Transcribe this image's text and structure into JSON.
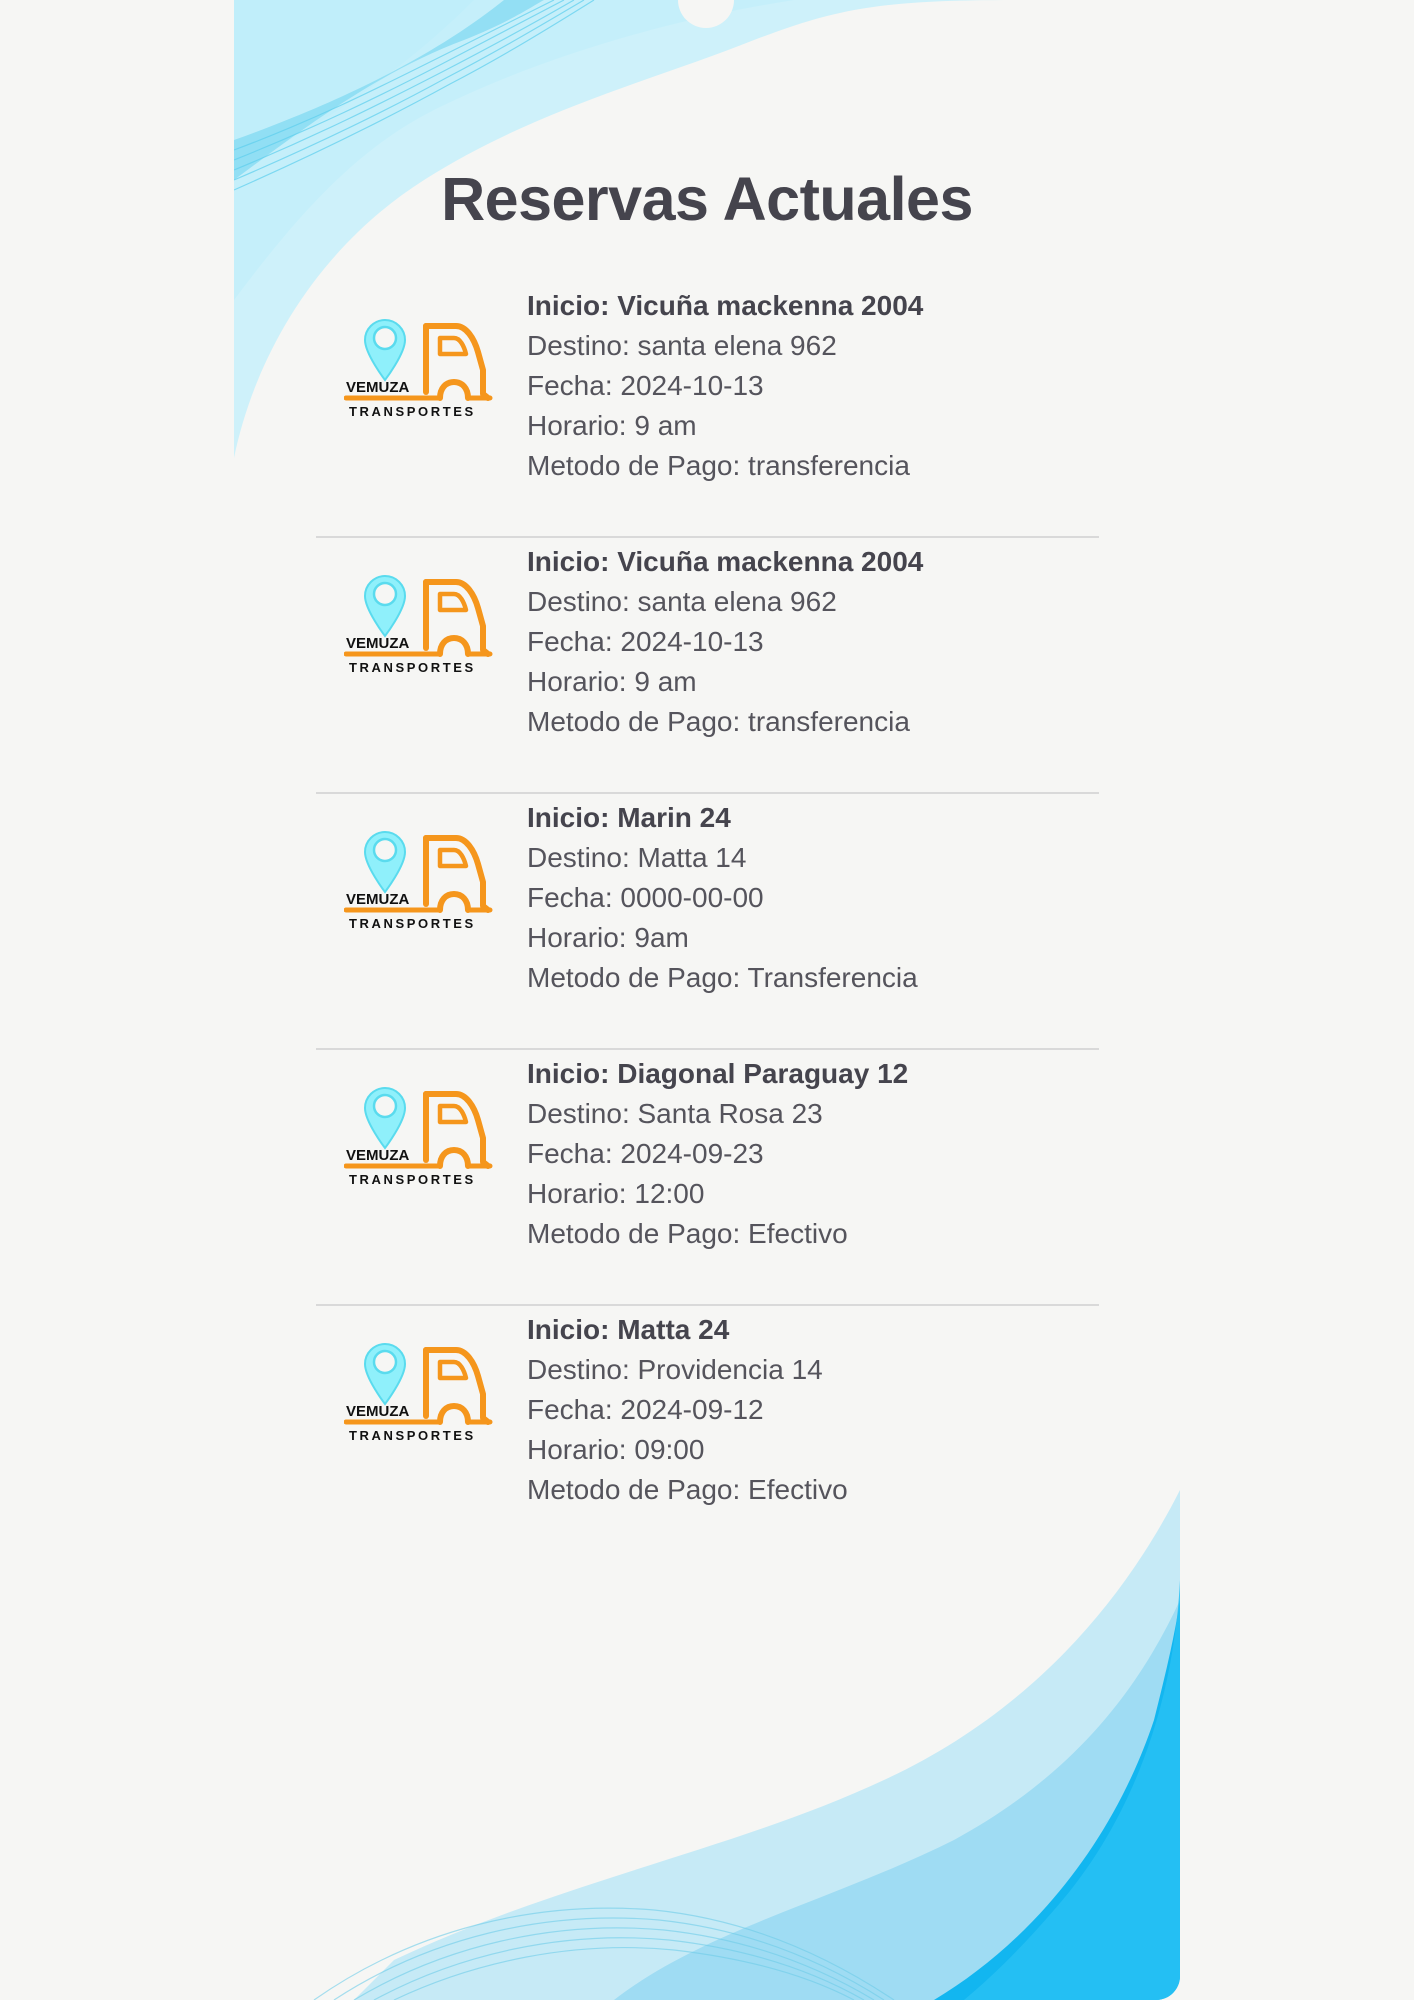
{
  "page_title": "Reservas Actuales",
  "logo": {
    "brand": "VEMUZA",
    "subtitle": "TRANSPORTES"
  },
  "colors": {
    "accent_orange": "#f5961c",
    "accent_cyan": "#6fe3f4",
    "wave_blue": "#12b6f0",
    "title": "#45444d",
    "text": "#55545c"
  },
  "reservations": [
    {
      "inicio": "Inicio: Vicuña mackenna 2004",
      "destino": "Destino: santa elena 962",
      "fecha": "Fecha: 2024-10-13",
      "horario": "Horario: 9 am",
      "pago": "Metodo de Pago: transferencia"
    },
    {
      "inicio": "Inicio: Vicuña mackenna 2004",
      "destino": "Destino: santa elena 962",
      "fecha": "Fecha: 2024-10-13",
      "horario": "Horario: 9 am",
      "pago": "Metodo de Pago: transferencia"
    },
    {
      "inicio": "Inicio: Marin 24",
      "destino": "Destino: Matta 14",
      "fecha": "Fecha: 0000-00-00",
      "horario": "Horario: 9am",
      "pago": "Metodo de Pago: Transferencia"
    },
    {
      "inicio": "Inicio: Diagonal Paraguay 12",
      "destino": "Destino: Santa Rosa 23",
      "fecha": "Fecha: 2024-09-23",
      "horario": "Horario: 12:00",
      "pago": "Metodo de Pago: Efectivo"
    },
    {
      "inicio": "Inicio: Matta 24",
      "destino": "Destino: Providencia 14",
      "fecha": "Fecha: 2024-09-12",
      "horario": "Horario: 09:00",
      "pago": "Metodo de Pago: Efectivo"
    }
  ]
}
